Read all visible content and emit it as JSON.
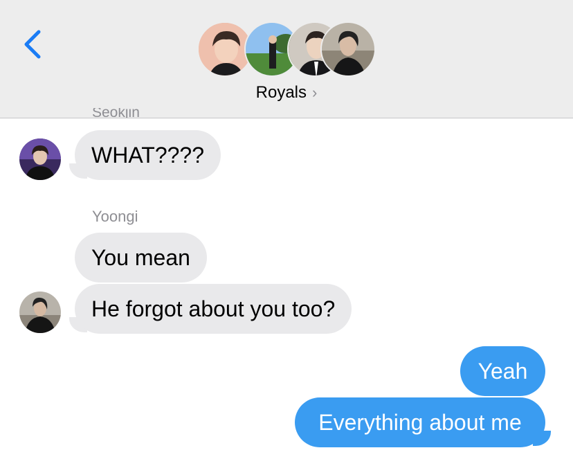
{
  "header": {
    "group_name": "Royals",
    "chevron": "›"
  },
  "icons": {
    "back": "chevron-left-icon",
    "group_chevron": "chevron-right-icon"
  },
  "colors": {
    "header_bg": "#ededed",
    "incoming_bubble": "#e9e9eb",
    "outgoing_bubble": "#3a9cf1",
    "accent_blue": "#1a7cf5",
    "meta_gray": "#8e8e93"
  },
  "messages": {
    "top_clipped_sender": "Seokjin",
    "m1": "WHAT????",
    "sender2": "Yoongi",
    "m2": "You mean",
    "m3": "He forgot about you too?",
    "m4": "Yeah",
    "m5": "Everything about me"
  }
}
